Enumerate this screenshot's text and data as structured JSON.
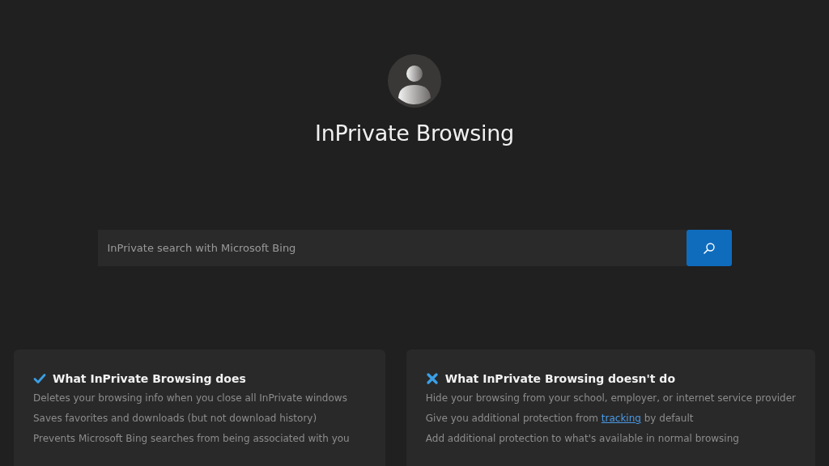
{
  "title": "InPrivate Browsing",
  "search": {
    "placeholder": "InPrivate search with Microsoft Bing"
  },
  "cards": [
    {
      "kind": "does",
      "heading": "What InPrivate Browsing does",
      "items": [
        [
          {
            "text": "Deletes your browsing info when you close all InPrivate windows"
          }
        ],
        [
          {
            "text": "Saves favorites and downloads (but not download history)"
          }
        ],
        [
          {
            "text": "Prevents Microsoft Bing searches from being associated with you"
          }
        ]
      ]
    },
    {
      "kind": "doesnt",
      "heading": "What InPrivate Browsing doesn't do",
      "items": [
        [
          {
            "text": "Hide your browsing from your school, employer, or internet service provider"
          }
        ],
        [
          {
            "text": "Give you additional protection from "
          },
          {
            "link": "tracking"
          },
          {
            "text": " by default"
          }
        ],
        [
          {
            "text": "Add additional protection to what's available in normal browsing"
          }
        ]
      ]
    }
  ]
}
